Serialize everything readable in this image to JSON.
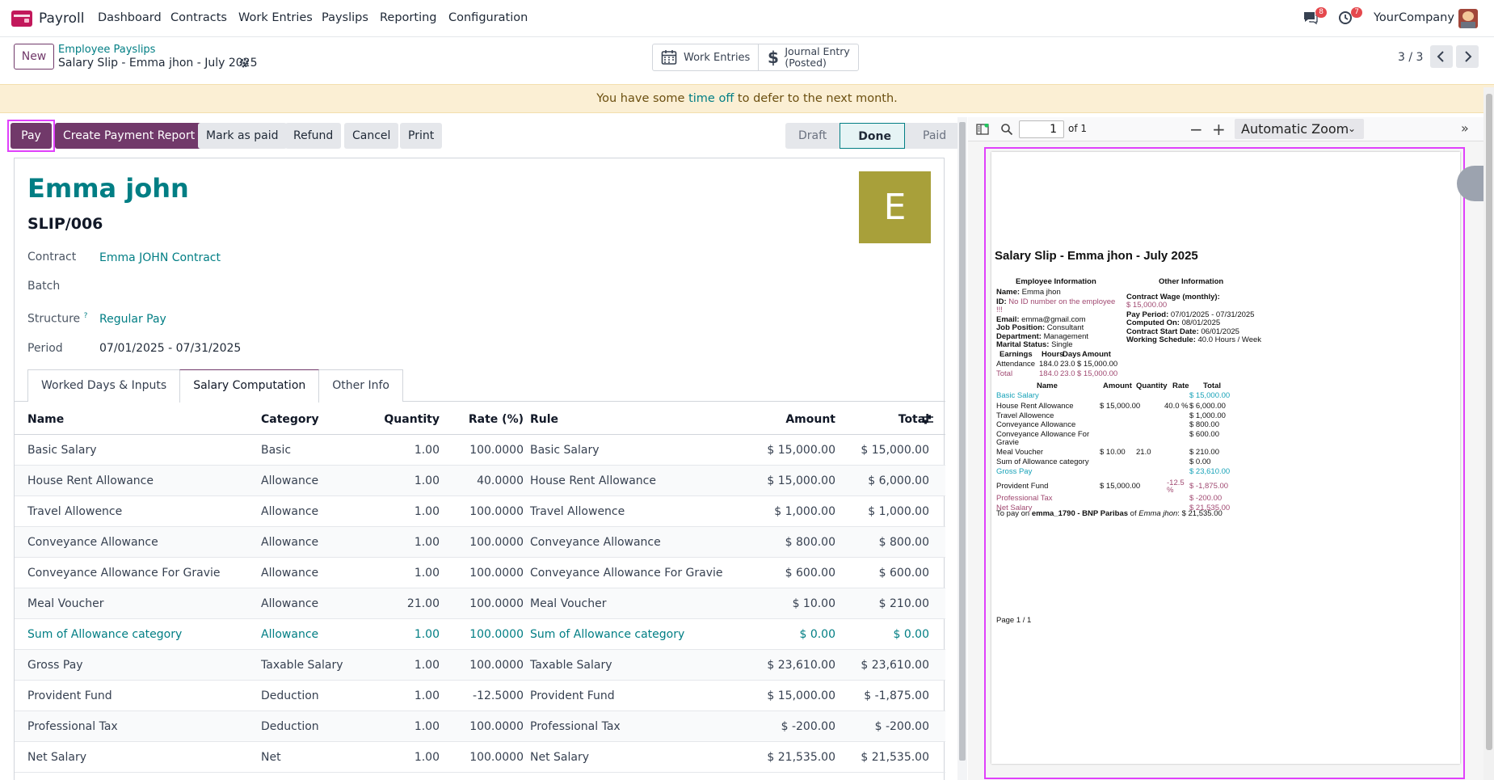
{
  "topnav": {
    "app_name": "Payroll",
    "menu": [
      "Dashboard",
      "Contracts",
      "Work Entries",
      "Payslips",
      "Reporting",
      "Configuration"
    ],
    "chat_badge": "8",
    "activity_badge": "7",
    "company": "YourCompany"
  },
  "control_panel": {
    "new_label": "New",
    "breadcrumb_parent": "Employee Payslips",
    "breadcrumb_current": "Salary Slip - Emma jhon - July 2025",
    "stat_work_entries": "Work Entries",
    "stat_journal_line1": "Journal Entry",
    "stat_journal_line2": "(Posted)",
    "pager": "3 / 3"
  },
  "alert": {
    "prefix": "You have some ",
    "link": "time off",
    "suffix": " to defer to the next month."
  },
  "actions": {
    "pay": "Pay",
    "create_payment_report": "Create Payment Report",
    "mark_as_paid": "Mark as paid",
    "refund": "Refund",
    "cancel": "Cancel",
    "print": "Print"
  },
  "stages": [
    "Draft",
    "Done",
    "Paid"
  ],
  "active_stage": "Done",
  "form": {
    "employee": "Emma john",
    "reference": "SLIP/006",
    "avatar_letter": "E",
    "contract_label": "Contract",
    "contract_value": "Emma JOHN Contract",
    "batch_label": "Batch",
    "structure_label": "Structure",
    "structure_help": "?",
    "structure_value": "Regular Pay",
    "period_label": "Period",
    "period_value": "07/01/2025 - 07/31/2025"
  },
  "tabs": [
    "Worked Days & Inputs",
    "Salary Computation",
    "Other Info"
  ],
  "table": {
    "headers": {
      "name": "Name",
      "category": "Category",
      "quantity": "Quantity",
      "rate": "Rate (%)",
      "rule": "Rule",
      "amount": "Amount",
      "total": "Total"
    },
    "rows": [
      {
        "name": "Basic Salary",
        "category": "Basic",
        "quantity": "1.00",
        "rate": "100.0000",
        "rule": "Basic Salary",
        "amount": "$ 15,000.00",
        "total": "$ 15,000.00"
      },
      {
        "name": "House Rent Allowance",
        "category": "Allowance",
        "quantity": "1.00",
        "rate": "40.0000",
        "rule": "House Rent Allowance",
        "amount": "$ 15,000.00",
        "total": "$ 6,000.00"
      },
      {
        "name": "Travel Allowence",
        "category": "Allowance",
        "quantity": "1.00",
        "rate": "100.0000",
        "rule": "Travel Allowence",
        "amount": "$ 1,000.00",
        "total": "$ 1,000.00"
      },
      {
        "name": "Conveyance Allowance",
        "category": "Allowance",
        "quantity": "1.00",
        "rate": "100.0000",
        "rule": "Conveyance Allowance",
        "amount": "$ 800.00",
        "total": "$ 800.00"
      },
      {
        "name": "Conveyance Allowance For Gravie",
        "category": "Allowance",
        "quantity": "1.00",
        "rate": "100.0000",
        "rule": "Conveyance Allowance For Gravie",
        "amount": "$ 600.00",
        "total": "$ 600.00"
      },
      {
        "name": "Meal Voucher",
        "category": "Allowance",
        "quantity": "21.00",
        "rate": "100.0000",
        "rule": "Meal Voucher",
        "amount": "$ 10.00",
        "total": "$ 210.00"
      },
      {
        "name": "Sum of Allowance category",
        "category": "Allowance",
        "quantity": "1.00",
        "rate": "100.0000",
        "rule": "Sum of Allowance category",
        "amount": "$ 0.00",
        "total": "$ 0.00"
      },
      {
        "name": "Gross Pay",
        "category": "Taxable Salary",
        "quantity": "1.00",
        "rate": "100.0000",
        "rule": "Taxable Salary",
        "amount": "$ 23,610.00",
        "total": "$ 23,610.00"
      },
      {
        "name": "Provident Fund",
        "category": "Deduction",
        "quantity": "1.00",
        "rate": "-12.5000",
        "rule": "Provident Fund",
        "amount": "$ 15,000.00",
        "total": "$ -1,875.00"
      },
      {
        "name": "Professional Tax",
        "category": "Deduction",
        "quantity": "1.00",
        "rate": "100.0000",
        "rule": "Professional Tax",
        "amount": "$ -200.00",
        "total": "$ -200.00"
      },
      {
        "name": "Net Salary",
        "category": "Net",
        "quantity": "1.00",
        "rate": "100.0000",
        "rule": "Net Salary",
        "amount": "$ 21,535.00",
        "total": "$ 21,535.00"
      }
    ]
  },
  "pdf_viewer": {
    "page_number": "1",
    "page_count": "of 1",
    "zoom": "Automatic Zoom",
    "doc": {
      "title": "Salary Slip - Emma jhon - July 2025",
      "emp_info_head": "Employee Information",
      "other_info_head": "Other Information",
      "name_label": "Name:",
      "name_value": " Emma jhon",
      "id_label": "ID:",
      "id_value": " No ID number on the employee",
      "id_tail": "!!!",
      "email_label": "Email:",
      "email_value": " emma@gmail.com",
      "job_label": "Job Position:",
      "job_value": " Consultant",
      "dept_label": "Department:",
      "dept_value": " Management",
      "marital_label": "Marital Status:",
      "marital_value": " Single",
      "wage_label": "Contract Wage (monthly):",
      "wage_value": "$ 15,000.00",
      "payperiod_label": "Pay Period:",
      "payperiod_value": " 07/01/2025 - 07/31/2025",
      "computed_label": "Computed On:",
      "computed_value": " 08/01/2025",
      "start_label": "Contract Start Date:",
      "start_value": " 06/01/2025",
      "schedule_label": "Working Schedule:",
      "schedule_value": " 40.0 Hours / Week",
      "earn_headers": [
        "Earnings",
        "Hours",
        "Days",
        "Amount"
      ],
      "earn_attendance": [
        "Attendance",
        "184.0",
        "23.0",
        "$ 15,000.00"
      ],
      "earn_total": [
        "Total",
        "184.0",
        "23.0",
        "$ 15,000.00"
      ],
      "line_headers": [
        "Name",
        "Amount",
        "Quantity",
        "Rate",
        "Total"
      ],
      "lines": [
        {
          "name": "Basic Salary",
          "amount": "",
          "qty": "",
          "rate": "",
          "total": "$ 15,000.00"
        },
        {
          "name": "House Rent Allowance",
          "amount": "$ 15,000.00",
          "qty": "",
          "rate": "40.0 %",
          "total": "$ 6,000.00"
        },
        {
          "name": "Travel Allowence",
          "amount": "",
          "qty": "",
          "rate": "",
          "total": "$ 1,000.00"
        },
        {
          "name": "Conveyance Allowance",
          "amount": "",
          "qty": "",
          "rate": "",
          "total": "$ 800.00"
        },
        {
          "name": "Conveyance Allowance For",
          "name2": "Gravie",
          "amount": "",
          "qty": "",
          "rate": "",
          "total": "$ 600.00"
        },
        {
          "name": "Meal Voucher",
          "amount": "$ 10.00",
          "qty": "21.0",
          "rate": "",
          "total": "$ 210.00"
        },
        {
          "name": "Sum of Allowance category",
          "amount": "",
          "qty": "",
          "rate": "",
          "total": "$ 0.00"
        },
        {
          "name": "Gross Pay",
          "amount": "",
          "qty": "",
          "rate": "",
          "total": "$ 23,610.00"
        },
        {
          "name": "Provident Fund",
          "amount": "$ 15,000.00",
          "qty": "",
          "rate": "-12.5",
          "rate2": "%",
          "total": "$ -1,875.00"
        },
        {
          "name": "Professional Tax",
          "amount": "",
          "qty": "",
          "rate": "",
          "total": "$ -200.00"
        },
        {
          "name": "Net Salary",
          "amount": "",
          "qty": "",
          "rate": "",
          "total": "$ 21,535.00"
        }
      ],
      "pay_prefix": "To pay on ",
      "pay_account": "emma_1790 - BNP Paribas",
      "pay_of": " of ",
      "pay_name": "Emma jhon",
      "pay_amount": ": $ 21,535.00",
      "footer": "Page 1 / 1"
    }
  },
  "colors": {
    "brand": "#71396a",
    "link": "#017e84",
    "alert_bg": "#fbefd4",
    "highlight": "#e040fb"
  }
}
